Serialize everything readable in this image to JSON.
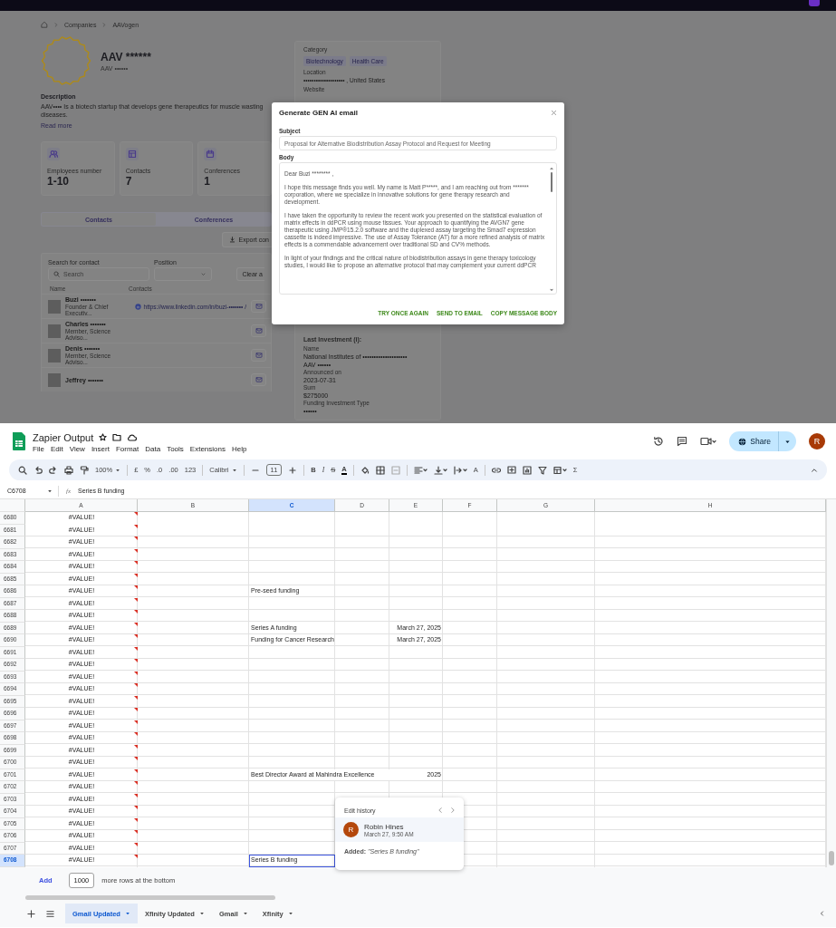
{
  "app": {
    "breadcrumb": [
      "Companies",
      "AAVogen"
    ],
    "company": {
      "name": "AAV ******",
      "alias": "AAV ••••••",
      "description_heading": "Description",
      "description": "AAV••••  Is a biotech startup that develops gene therapeutics for muscle wasting diseases.",
      "read_more": "Read more"
    },
    "stats": [
      {
        "kind": "people",
        "label": "Employees number",
        "value": "1-10"
      },
      {
        "kind": "board",
        "label": "Contacts",
        "value": "7"
      },
      {
        "kind": "calendar",
        "label": "Conferences",
        "value": "1"
      }
    ],
    "tabs": [
      {
        "label": "Contacts",
        "selected": true
      },
      {
        "label": "Conferences",
        "selected": false
      }
    ],
    "export_button": "Export con",
    "filters": {
      "search_label": "Search for contact",
      "search_placeholder": "Search",
      "position_label": "Position",
      "clear_button": "Clear a"
    },
    "contact_columns": [
      "Name",
      "Contacts"
    ],
    "contacts": [
      {
        "name": "Buzi •••••••",
        "role": "Founder & Chief Executiv...",
        "link": "https://www.linkedin.com/in/buzi-••••••• /"
      },
      {
        "name": "Charles •••••••",
        "role": "Member, Science Adviso..."
      },
      {
        "name": "Denis •••••••",
        "role": "Member, Science Adviso..."
      },
      {
        "name": "Jeffrey •••••••"
      }
    ],
    "details": {
      "category_label": "Category",
      "tags": [
        "Biotechnology",
        "Health Care"
      ],
      "location_label": "Location",
      "location": "•••••••••••••••••••• , United States",
      "website_label": "Website",
      "investment_heading": "Last Investment (i):",
      "investment": [
        {
          "kind": "label",
          "text": "Name"
        },
        {
          "kind": "value",
          "text": "National Institutes of ••••••••••••••••••••"
        },
        {
          "kind": "value",
          "text": "AAV ••••••"
        },
        {
          "kind": "label",
          "text": "Announced on"
        },
        {
          "kind": "value",
          "text": "2023-07-31"
        },
        {
          "kind": "label",
          "text": "Sum"
        },
        {
          "kind": "value",
          "text": "$275000"
        },
        {
          "kind": "label",
          "text": "Funding Investment Type"
        },
        {
          "kind": "value",
          "text": "••••••"
        }
      ]
    },
    "modal": {
      "title": "Generate GEN AI email",
      "subject_label": "Subject",
      "subject": "Proposal for Alternative Biodistribution Assay Protocol and Request for Meeting",
      "body_label": "Body",
      "body": [
        "Dear Buzi ******** ,",
        "I hope this message finds you well. My name is Matt P*****, and I am reaching out from ******* corporation, where we specialize in innovative solutions for gene therapy research and development.",
        "I have taken the opportunity to review the recent work you presented on the statistical evaluation of matrix effects in ddPCR using mouse tissues. Your approach to quantifying the AVGN7 gene therapeutic using JMP®15.2.0 software and the duplexed assay targeting the Smad7 expression cassette is indeed impressive. The use of Assay Tolerance (AT) for a more refined analysis of matrix effects is a commendable advancement over traditional SD and CV% methods.",
        "In light of your findings and the critical nature of biodistribution assays in gene therapy toxicology studies, I would like to propose an alternative protocol that may complement your current ddPCR"
      ],
      "actions": [
        "TRY ONCE AGAIN",
        "SEND TO EMAIL",
        "COPY MESSAGE BODY"
      ]
    }
  },
  "sheet": {
    "title": "Zapier Output",
    "menu": [
      "File",
      "Edit",
      "View",
      "Insert",
      "Format",
      "Data",
      "Tools",
      "Extensions",
      "Help"
    ],
    "share": "Share",
    "account": "R",
    "toolbar": {
      "zoom": "100%",
      "currency": "£",
      "percent": "%",
      "decrease_decimal": ".0",
      "increase_decimal": ".00",
      "number_format": "123",
      "font": "Calibri",
      "font_size": "11",
      "bold": "B",
      "italic": "I",
      "strikethrough": "S",
      "text_color": "A",
      "text_rotation": "A",
      "sum": "Σ"
    },
    "name_box": "C6708",
    "formula_label": "fx",
    "formula": "Series B funding",
    "columns": [
      {
        "label": "A",
        "selected": false
      },
      {
        "label": "B",
        "selected": false
      },
      {
        "label": "C",
        "selected": true
      },
      {
        "label": "D",
        "selected": false
      },
      {
        "label": "E",
        "selected": false
      },
      {
        "label": "F",
        "selected": false
      },
      {
        "label": "G",
        "selected": false
      },
      {
        "label": "H",
        "selected": false
      }
    ],
    "rows": [
      {
        "number": "6680",
        "selected": false,
        "a": "#VALUE!"
      },
      {
        "number": "6681",
        "selected": false,
        "a": "#VALUE!"
      },
      {
        "number": "6682",
        "selected": false,
        "a": "#VALUE!"
      },
      {
        "number": "6683",
        "selected": false,
        "a": "#VALUE!"
      },
      {
        "number": "6684",
        "selected": false,
        "a": "#VALUE!"
      },
      {
        "number": "6685",
        "selected": false,
        "a": "#VALUE!"
      },
      {
        "number": "6686",
        "selected": false,
        "a": "#VALUE!",
        "c": "Pre-seed funding"
      },
      {
        "number": "6687",
        "selected": false,
        "a": "#VALUE!"
      },
      {
        "number": "6688",
        "selected": false,
        "a": "#VALUE!"
      },
      {
        "number": "6689",
        "selected": false,
        "a": "#VALUE!",
        "c": "Series A funding",
        "e": "March 27, 2025"
      },
      {
        "number": "6690",
        "selected": false,
        "a": "#VALUE!",
        "c": "Funding for Cancer Research",
        "e": "March 27, 2025"
      },
      {
        "number": "6691",
        "selected": false,
        "a": "#VALUE!"
      },
      {
        "number": "6692",
        "selected": false,
        "a": "#VALUE!"
      },
      {
        "number": "6693",
        "selected": false,
        "a": "#VALUE!"
      },
      {
        "number": "6694",
        "selected": false,
        "a": "#VALUE!"
      },
      {
        "number": "6695",
        "selected": false,
        "a": "#VALUE!"
      },
      {
        "number": "6696",
        "selected": false,
        "a": "#VALUE!"
      },
      {
        "number": "6697",
        "selected": false,
        "a": "#VALUE!"
      },
      {
        "number": "6698",
        "selected": false,
        "a": "#VALUE!"
      },
      {
        "number": "6699",
        "selected": false,
        "a": "#VALUE!"
      },
      {
        "number": "6700",
        "selected": false,
        "a": "#VALUE!"
      },
      {
        "number": "6701",
        "selected": false,
        "a": "#VALUE!",
        "c": "Best Director Award at Mahindra Excellence",
        "e": "2025"
      },
      {
        "number": "6702",
        "selected": false,
        "a": "#VALUE!"
      },
      {
        "number": "6703",
        "selected": false,
        "a": "#VALUE!"
      },
      {
        "number": "6704",
        "selected": false,
        "a": "#VALUE!"
      },
      {
        "number": "6705",
        "selected": false,
        "a": "#VALUE!"
      },
      {
        "number": "6706",
        "selected": false,
        "a": "#VALUE!"
      },
      {
        "number": "6707",
        "selected": false,
        "a": "#VALUE!"
      },
      {
        "number": "6708",
        "selected": true,
        "a": "#VALUE!",
        "c": "Series B funding"
      }
    ],
    "add": {
      "button": "Add",
      "count": "1000",
      "suffix": "more rows at the bottom"
    },
    "tabs": [
      {
        "label": "Gmail Updated",
        "selected": true
      },
      {
        "label": "Xfinity Updated",
        "selected": false
      },
      {
        "label": "Gmail",
        "selected": false
      },
      {
        "label": "Xfinity",
        "selected": false
      }
    ],
    "edit_history": {
      "title": "Edit history",
      "avatar": "R",
      "user": "Robin Hines",
      "time": "March 27, 9:50 AM",
      "change": "**Added:** *\"Series B funding\"*"
    }
  }
}
